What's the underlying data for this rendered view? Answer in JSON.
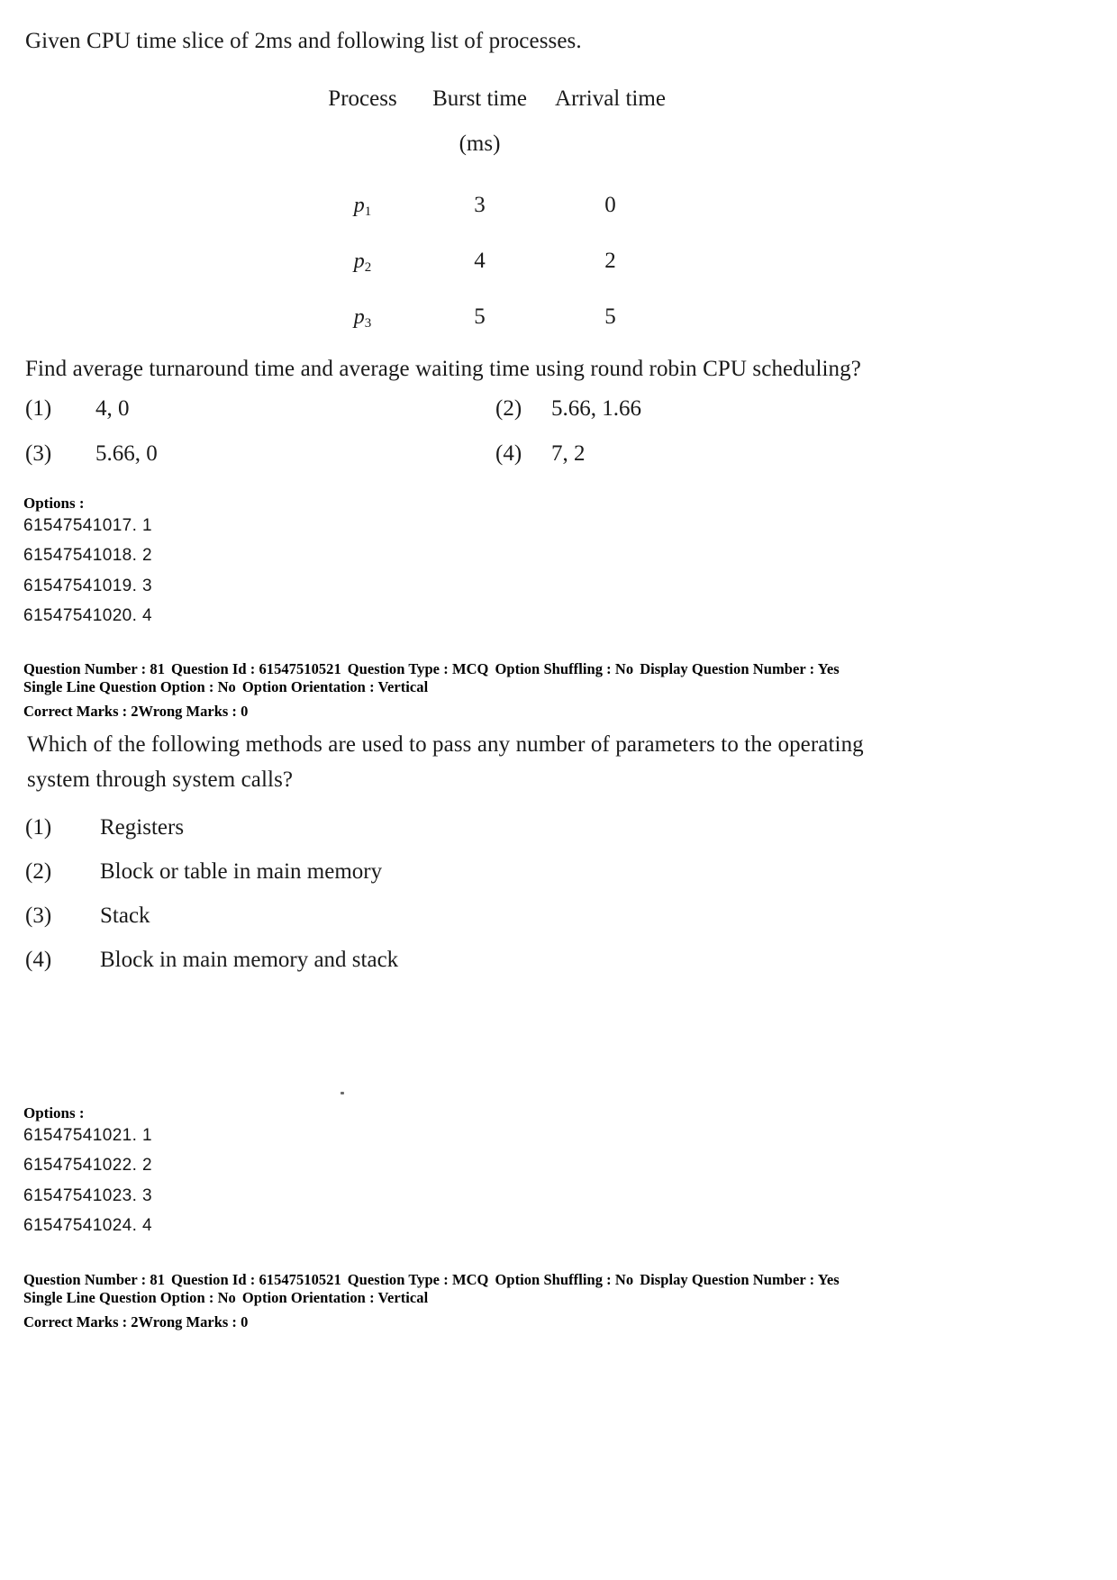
{
  "document": {
    "type": "exam-question-paper"
  },
  "question1": {
    "stem": "Given CPU time slice of 2ms and following list of processes.",
    "table": {
      "headers": [
        "Process",
        "Burst time",
        "Arrival time"
      ],
      "unit_row": [
        "",
        "(ms)",
        ""
      ],
      "rows": [
        {
          "process": "p",
          "subscript": "1",
          "burst": "3",
          "arrival": "0"
        },
        {
          "process": "p",
          "subscript": "2",
          "burst": "4",
          "arrival": "2"
        },
        {
          "process": "p",
          "subscript": "3",
          "burst": "5",
          "arrival": "5"
        }
      ]
    },
    "prompt": "Find average turnaround time and average waiting time using round robin CPU scheduling?",
    "choices": [
      {
        "num": "(1)",
        "text": "4, 0"
      },
      {
        "num": "(2)",
        "text": "5.66, 1.66"
      },
      {
        "num": "(3)",
        "text": "5.66, 0"
      },
      {
        "num": "(4)",
        "text": "7, 2"
      }
    ],
    "options_label": "Options :",
    "option_ids": [
      "61547541017. 1",
      "61547541018. 2",
      "61547541019. 3",
      "61547541020. 4"
    ],
    "meta": {
      "question_number_label": "Question Number :",
      "question_number": "81",
      "question_id_label": "Question Id :",
      "question_id": "61547510521",
      "question_type_label": "Question Type :",
      "question_type": "MCQ",
      "option_shuffling_label": "Option Shuffling :",
      "option_shuffling": "No",
      "display_question_number_label": "Display Question Number :",
      "display_question_number": "Yes",
      "single_line_option_label": "Single Line Question Option :",
      "single_line_option": "No",
      "option_orientation_label": "Option Orientation :",
      "option_orientation": "Vertical",
      "correct_marks_label": "Correct Marks :",
      "correct_marks": "2",
      "wrong_marks_label": "Wrong Marks :",
      "wrong_marks": "0"
    }
  },
  "question2": {
    "stem_line1": "Which of the following methods are used to pass any number of parameters to the operating",
    "stem_line2": "system through system calls?",
    "choices": [
      {
        "num": "(1)",
        "text": "Registers"
      },
      {
        "num": "(2)",
        "text": "Block or table in main memory"
      },
      {
        "num": "(3)",
        "text": "Stack"
      },
      {
        "num": "(4)",
        "text": "Block in main memory and stack"
      }
    ],
    "options_label": "Options :",
    "option_ids": [
      "61547541021. 1",
      "61547541022. 2",
      "61547541023. 3",
      "61547541024. 4"
    ],
    "meta": {
      "question_number_label": "Question Number :",
      "question_number": "81",
      "question_id_label": "Question Id :",
      "question_id": "61547510521",
      "question_type_label": "Question Type :",
      "question_type": "MCQ",
      "option_shuffling_label": "Option Shuffling :",
      "option_shuffling": "No",
      "display_question_number_label": "Display Question Number :",
      "display_question_number": "Yes",
      "single_line_option_label": "Single Line Question Option :",
      "single_line_option": "No",
      "option_orientation_label": "Option Orientation :",
      "option_orientation": "Vertical",
      "correct_marks_label": "Correct Marks :",
      "correct_marks": "2",
      "wrong_marks_label": "Wrong Marks :",
      "wrong_marks": "0"
    }
  }
}
